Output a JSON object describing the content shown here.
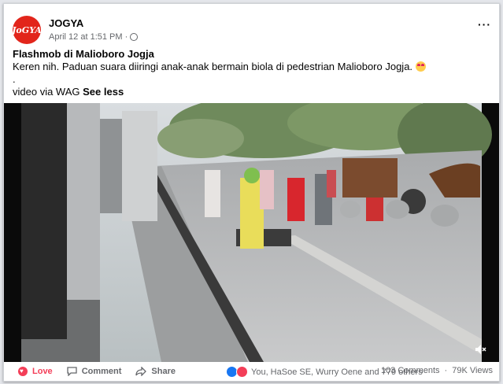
{
  "post": {
    "page_name": "JOGYA",
    "avatar_text": "JoGYA",
    "timestamp": "April 12 at 1:51 PM",
    "separator": "·",
    "more_glyph": "···",
    "title": "Flashmob di Malioboro Jogja",
    "body": "Keren nih. Paduan suara diiringi anak-anak bermain biola di pedestrian Malioboro Jogja.",
    "dot_line": ".",
    "video_credit": "video via WAG",
    "see_less": "See less"
  },
  "video": {
    "icon": "volume-mute-icon"
  },
  "footer": {
    "love_label": "Love",
    "comment_label": "Comment",
    "share_label": "Share",
    "reactions_text": "You, HaSoe SE, Wurry Oene and 779 others",
    "comments_count": "103 Comments",
    "views_count": "79K Views"
  },
  "colors": {
    "brand_red": "#e2251b",
    "love_red": "#f33e58",
    "like_blue": "#1877f2",
    "meta_gray": "#65676b"
  }
}
